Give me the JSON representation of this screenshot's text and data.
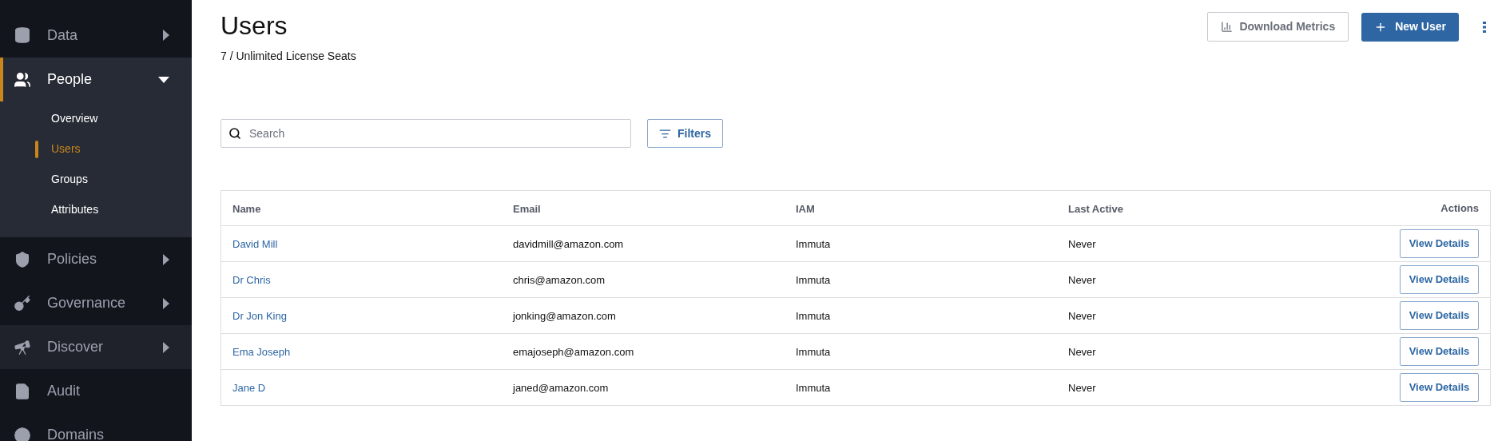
{
  "sidebar": {
    "items": [
      {
        "label": "Data",
        "expanded": false,
        "selected": false
      },
      {
        "label": "People",
        "expanded": true,
        "selected": true,
        "children": [
          {
            "label": "Overview",
            "selected": false
          },
          {
            "label": "Users",
            "selected": true
          },
          {
            "label": "Groups",
            "selected": false
          },
          {
            "label": "Attributes",
            "selected": false
          }
        ]
      },
      {
        "label": "Policies",
        "expanded": false,
        "selected": false
      },
      {
        "label": "Governance",
        "expanded": false,
        "selected": false
      },
      {
        "label": "Discover",
        "expanded": false,
        "selected": false,
        "hovered": true
      },
      {
        "label": "Audit",
        "selected": false
      },
      {
        "label": "Domains",
        "selected": false
      }
    ]
  },
  "page": {
    "title": "Users",
    "subtitle": "7 / Unlimited License Seats",
    "actions": [
      {
        "label": "Download Metrics",
        "kind": "secondary"
      },
      {
        "label": "New User",
        "kind": "primary"
      }
    ]
  },
  "search": {
    "placeholder": "Search"
  },
  "filters": {
    "label": "Filters"
  },
  "table": {
    "columns": [
      "Name",
      "Email",
      "IAM",
      "Last Active",
      "Actions"
    ],
    "rows": [
      {
        "name": "David Mill",
        "email": "davidmill@amazon.com",
        "iam": "Immuta",
        "last_active": "Never",
        "action": "View Details"
      },
      {
        "name": "Dr Chris",
        "email": "chris@amazon.com",
        "iam": "Immuta",
        "last_active": "Never",
        "action": "View Details"
      },
      {
        "name": "Dr Jon King",
        "email": "jonking@amazon.com",
        "iam": "Immuta",
        "last_active": "Never",
        "action": "View Details"
      },
      {
        "name": "Ema Joseph",
        "email": "emajoseph@amazon.com",
        "iam": "Immuta",
        "last_active": "Never",
        "action": "View Details"
      },
      {
        "name": "Jane D",
        "email": "janed@amazon.com",
        "iam": "Immuta",
        "last_active": "Never",
        "action": "View Details"
      }
    ]
  }
}
